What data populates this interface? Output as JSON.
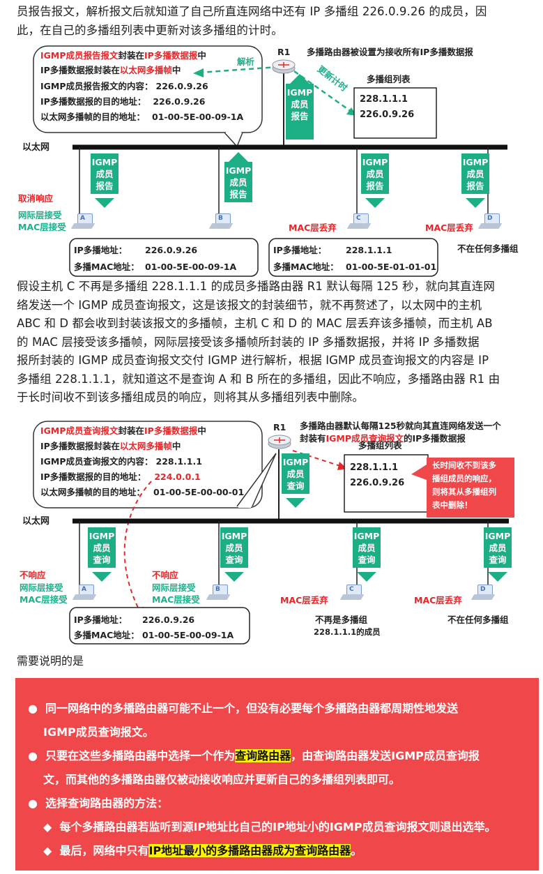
{
  "paragraphs": {
    "p1_line1": "员报告报文，解析报文后就知道了自己所直连网络中还有 IP 多播组 226.0.9.26 的成员，因",
    "p1_line2": "此，在自己的多播组列表中更新对该多播组的计时。",
    "p2_lines": [
      "假设主机 C 不再是多播组 228.1.1.1 的成员多播路由器 R1 默认每隔 125 秒，就向其直连网",
      "络发送一个 IGMP 成员查询报文，这是该报文的封装细节，就不再赘述了，以太网中的主机",
      "ABC 和 D 都会收到封装该报文的多播帧，主机 C 和 D 的 MAC 层丢弃该多播帧，而主机 AB",
      "的 MAC 层接受该多播帧，网际层接受该多播帧所封装的 IP 多播数据报，并将 IP 多播数据",
      "报所封装的 IGMP 成员查询报文交付 IGMP 进行解析，根据 IGMP 成员查询报文的内容是 IP",
      "多播组 228.1.1.1，就知道这不是查询 A 和 B 所在的多播组，因此不响应，多播路由器 R1 由",
      "于长时间收不到该多播组成员的响应，则将其从多播组列表中删除。"
    ]
  },
  "figure1": {
    "bubble": {
      "l1_a": "IGMP成员报告报文",
      "l1_b": "封装在",
      "l1_c": "IP多播数据报",
      "l1_d": "中",
      "l2_a": "IP多播数据报封装在",
      "l2_b": "以太网多播帧",
      "l2_c": "中",
      "l3_k": "IGMP成员报告报文的内容：",
      "l3_v": "226.0.9.26",
      "l4_k": "IP多播数据报的目的地址：",
      "l4_v": "226.0.9.26",
      "l5_k": "以太网多播帧的目的地址：",
      "l5_v": "01-00-5E-00-09-1A"
    },
    "router_label": "R1",
    "router_caption": "多播路由器被设置为接收所有IP多播数据报",
    "parse_label": "解析",
    "update_label": "更新计时",
    "igmp_up_lines": [
      "IGMP",
      "成员",
      "报告"
    ],
    "list_title": "多播组列表",
    "list_items": [
      "228.1.1.1",
      "226.0.9.26"
    ],
    "ethernet_label": "以太网",
    "igmp_labels": [
      [
        "IGMP",
        "成员",
        "报告"
      ],
      [
        "IGMP",
        "成员",
        "报告"
      ],
      [
        "IGMP",
        "成员",
        "报告"
      ],
      [
        "IGMP",
        "成员",
        "报告"
      ]
    ],
    "host_a_status1": "取消响应",
    "host_a_status2": "网际层接受",
    "host_a_status3": "MAC层接受",
    "host_c_status": "MAC层丢弃",
    "host_d_status": "MAC层丢弃",
    "hosts": [
      "A",
      "B",
      "C",
      "D"
    ],
    "ab_info": {
      "ip_k": "IP多播地址：",
      "ip_v": "226.0.9.26",
      "mac_k": "多播MAC地址：",
      "mac_v": "01-00-5E-00-09-1A"
    },
    "c_info": {
      "ip_k": "IP多播地址：",
      "ip_v": "228.1.1.1",
      "mac_k": "多播MAC地址：",
      "mac_v": "01-00-5E-01-01-01"
    },
    "d_info": "不在任何多播组"
  },
  "figure2": {
    "bubble": {
      "l1_a": "IGMP成员查询报文",
      "l1_b": "封装在",
      "l1_c": "IP多播数据报",
      "l1_d": "中",
      "l2_a": "IP多播数据报封装在",
      "l2_b": "以太网多播帧",
      "l2_c": "中",
      "l3_k": "IGMP成员查询报文的内容：",
      "l3_v": "228.1.1.1",
      "l4_k": "IP多播数据报的目的地址：",
      "l4_v": "224.0.0.1",
      "l5_k": "以太网多播帧的目的地址：",
      "l5_v": "01-00-5E-00-00-01"
    },
    "router_label": "R1",
    "router_caption1": "多播路由器默认每隔125秒就向其直连网络发送一个",
    "router_caption2_a": "封装有",
    "router_caption2_b": "IGMP成员查询报文",
    "router_caption2_c": "的IP多播数据报",
    "igmp_down_lines": [
      "IGMP",
      "成员",
      "查询"
    ],
    "list_title": "多播组列表",
    "list_items": [
      "228.1.1.1",
      "226.0.9.26"
    ],
    "callout_lines": [
      "长时间收不到该多",
      "播组成员的响应，",
      "则将其从多播组列",
      "表中删除！"
    ],
    "ethernet_label": "以太网",
    "igmp_labels": [
      [
        "IGMP",
        "成员",
        "查询"
      ],
      [
        "IGMP",
        "成员",
        "查询"
      ],
      [
        "IGMP",
        "成员",
        "查询"
      ],
      [
        "IGMP",
        "成员",
        "查询"
      ]
    ],
    "host_a_status1": "不响应",
    "host_a_status2": "网际层接受",
    "host_a_status3": "MAC层接受",
    "host_b_status1": "不响应",
    "host_b_status2": "网际层接受",
    "host_b_status3": "MAC层接受",
    "host_c_status": "MAC层丢弃",
    "host_d_status": "MAC层丢弃",
    "hosts": [
      "A",
      "B",
      "C",
      "D"
    ],
    "ab_info": {
      "ip_k": "IP多播地址：",
      "ip_v": "226.0.9.26",
      "mac_k": "多播MAC地址：",
      "mac_v": "01-00-5E-00-09-1A"
    },
    "c_info1": "不再是多播组",
    "c_info2": "228.1.1.1的成员",
    "d_info": "不在任何多播组"
  },
  "note": "需要说明的是",
  "bullets": {
    "b1_l1": "同一网络中的多播路由器可能不止一个，但没有必要每个多播路由器都周期性地发送",
    "b1_l2": "IGMP成员查询报文。",
    "b2_l1_a": "只要在这些多播路由器中选择一个作为",
    "b2_l1_hl": "查询路由器",
    "b2_l1_b": "，由查询路由器发送IGMP成员查询报",
    "b2_l2": "文，而其他的多播路由器仅被动接收响应并更新自己的多播组列表即可。",
    "b3": "选择查询路由器的方法：",
    "b3_sub1": "每个多播路由器若监听到源IP地址比自己的IP地址小的IGMP成员查询报文则退出选举。",
    "b3_sub2_a": "最后，网络中只有",
    "b3_sub2_hl": "IP地址最小的多播路由器成为查询路由器",
    "b3_sub2_b": "。"
  },
  "colors": {
    "red": "#e8262a",
    "green": "#1cae85",
    "banner": "#f0474b",
    "highlight": "#fff200"
  }
}
